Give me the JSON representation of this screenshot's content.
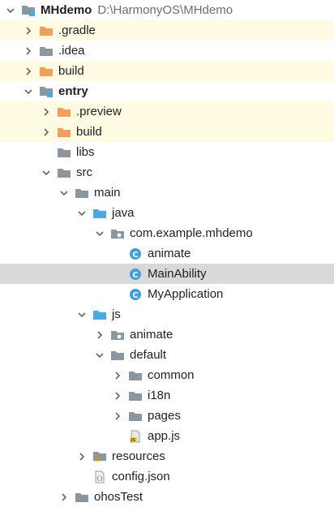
{
  "colors": {
    "folder_gray": "#8a96a0",
    "folder_orange": "#f39e5a",
    "folder_blue": "#49a9e4",
    "class_icon": "#3da0d8",
    "highlight_yellow": "#fffbe3",
    "selected_row": "#d9d9d9"
  },
  "tree": [
    {
      "label": "MHdemo",
      "path": "D:\\HarmonyOS\\MHdemo",
      "level": 0,
      "arrow": "down",
      "icon": "module-folder-icon",
      "bold": true
    },
    {
      "label": ".gradle",
      "level": 1,
      "arrow": "right",
      "icon": "orange-folder-icon",
      "highlight": "yellow"
    },
    {
      "label": ".idea",
      "level": 1,
      "arrow": "right",
      "icon": "gray-folder-icon"
    },
    {
      "label": "build",
      "level": 1,
      "arrow": "right",
      "icon": "orange-folder-icon",
      "highlight": "yellow"
    },
    {
      "label": "entry",
      "level": 1,
      "arrow": "down",
      "icon": "module-folder-icon",
      "bold": true
    },
    {
      "label": ".preview",
      "level": 2,
      "arrow": "right",
      "icon": "orange-folder-icon",
      "highlight": "yellow"
    },
    {
      "label": "build",
      "level": 2,
      "arrow": "right",
      "icon": "orange-folder-icon",
      "highlight": "yellow"
    },
    {
      "label": "libs",
      "level": 2,
      "arrow": "none",
      "icon": "gray-folder-icon"
    },
    {
      "label": "src",
      "level": 2,
      "arrow": "down",
      "icon": "gray-folder-icon"
    },
    {
      "label": "main",
      "level": 3,
      "arrow": "down",
      "icon": "gray-folder-icon"
    },
    {
      "label": "java",
      "level": 4,
      "arrow": "down",
      "icon": "blue-folder-icon"
    },
    {
      "label": "com.example.mhdemo",
      "level": 5,
      "arrow": "down",
      "icon": "package-icon"
    },
    {
      "label": "animate",
      "level": 6,
      "arrow": "none",
      "icon": "class-icon"
    },
    {
      "label": "MainAbility",
      "level": 6,
      "arrow": "none",
      "icon": "class-icon",
      "highlight": "select"
    },
    {
      "label": "MyApplication",
      "level": 6,
      "arrow": "none",
      "icon": "class-icon"
    },
    {
      "label": "js",
      "level": 4,
      "arrow": "down",
      "icon": "blue-folder-icon"
    },
    {
      "label": "animate",
      "level": 5,
      "arrow": "right",
      "icon": "package-icon"
    },
    {
      "label": "default",
      "level": 5,
      "arrow": "down",
      "icon": "gray-folder-icon"
    },
    {
      "label": "common",
      "level": 6,
      "arrow": "right",
      "icon": "gray-folder-icon"
    },
    {
      "label": "i18n",
      "level": 6,
      "arrow": "right",
      "icon": "gray-folder-icon"
    },
    {
      "label": "pages",
      "level": 6,
      "arrow": "right",
      "icon": "gray-folder-icon"
    },
    {
      "label": "app.js",
      "level": 6,
      "arrow": "none",
      "icon": "js-file-icon"
    },
    {
      "label": "resources",
      "level": 4,
      "arrow": "right",
      "icon": "resources-folder-icon"
    },
    {
      "label": "config.json",
      "level": 4,
      "arrow": "none",
      "icon": "json-file-icon"
    },
    {
      "label": "ohosTest",
      "level": 3,
      "arrow": "right",
      "icon": "gray-folder-icon"
    }
  ]
}
